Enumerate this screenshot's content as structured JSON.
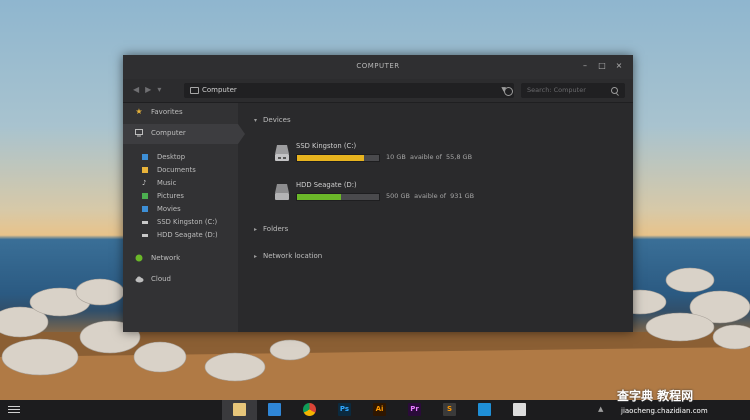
{
  "window": {
    "title": "COMPUTER",
    "controls": [
      "–",
      "□",
      "×"
    ]
  },
  "toolbar": {
    "back_icon": "arrow-left-icon",
    "forward_icon": "arrow-right-icon",
    "up_icon": "dropdown-icon",
    "address": "Computer",
    "search_placeholder": "Search: Computer"
  },
  "sidebar": {
    "favorites": "Favorites",
    "computer": "Computer",
    "places": [
      {
        "label": "Desktop",
        "icon": "desktop-icon",
        "color": "#3d8fd6"
      },
      {
        "label": "Documents",
        "icon": "folder-icon",
        "color": "#e8b33a"
      },
      {
        "label": "Music",
        "icon": "music-icon",
        "color": "#c9c9c9"
      },
      {
        "label": "Pictures",
        "icon": "pictures-icon",
        "color": "#4caf50"
      },
      {
        "label": "Movies",
        "icon": "movies-icon",
        "color": "#3d8fd6"
      },
      {
        "label": "SSD Kingston (C:)",
        "icon": "drive-icon",
        "color": "#c9c9c9"
      },
      {
        "label": "HDD Seagate (D:)",
        "icon": "drive-icon",
        "color": "#c9c9c9"
      }
    ],
    "network": "Network",
    "cloud": "Cloud"
  },
  "main": {
    "devices_label": "Devices",
    "folders_label": "Folders",
    "network_location_label": "Network location",
    "drives": [
      {
        "name": "SSD Kingston (C:)",
        "free": "10 GB",
        "avail_text": "avaible of",
        "total": "55,8 GB",
        "used_fraction": 0.82,
        "bar_color": "#e8b41f"
      },
      {
        "name": "HDD Seagate (D:)",
        "free": "500 GB",
        "avail_text": "avaible of",
        "total": "931 GB",
        "used_fraction": 0.54,
        "bar_color": "#6bb829"
      }
    ]
  },
  "taskbar": {
    "apps": [
      {
        "name": "files",
        "label": "",
        "bg": "#e7c67a",
        "fg": "#5a3e00",
        "active": true
      },
      {
        "name": "dropbox",
        "label": "",
        "bg": "#2f86d6",
        "fg": "#ffffff",
        "active": false
      },
      {
        "name": "chrome",
        "label": "",
        "bg": "#e6e6e6",
        "fg": "#333",
        "active": false
      },
      {
        "name": "photoshop",
        "label": "Ps",
        "bg": "#0b2a3f",
        "fg": "#31a8ff",
        "active": false
      },
      {
        "name": "illustrator",
        "label": "Ai",
        "bg": "#2f1600",
        "fg": "#ff9a00",
        "active": false
      },
      {
        "name": "premiere",
        "label": "Pr",
        "bg": "#2a0b3a",
        "fg": "#e77cff",
        "active": false
      },
      {
        "name": "sublime",
        "label": "S",
        "bg": "#3a3a3a",
        "fg": "#ff9800",
        "active": false
      },
      {
        "name": "vm",
        "label": "",
        "bg": "#1f8fd6",
        "fg": "#fff",
        "active": false
      },
      {
        "name": "photos",
        "label": "",
        "bg": "#dcdcdc",
        "fg": "#3a7bd5",
        "active": false
      }
    ],
    "tray_arrow": "▲"
  },
  "watermark": {
    "line1": "查字典 教程网",
    "line2": "jiaocheng.chazidian.com"
  }
}
